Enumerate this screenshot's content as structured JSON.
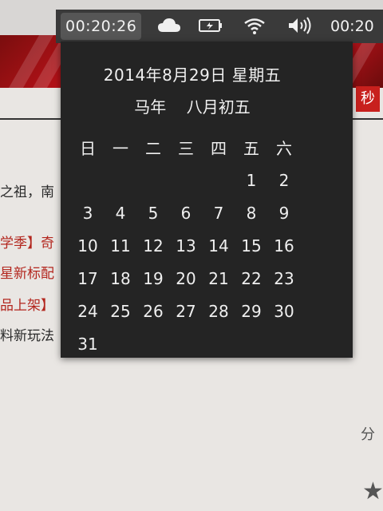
{
  "panel": {
    "clock_time": "00:20:26",
    "right_clock": "00:20",
    "icons": [
      "cloud-icon",
      "battery-icon",
      "wifi-icon",
      "volume-icon"
    ]
  },
  "calendar": {
    "date_line": "2014年8月29日 星期五",
    "lunar_line": "马年    八月初五",
    "weekdays": [
      "日",
      "一",
      "二",
      "三",
      "四",
      "五",
      "六"
    ],
    "weeks": [
      [
        "",
        "",
        "",
        "",
        "",
        "1",
        "2"
      ],
      [
        "3",
        "4",
        "5",
        "6",
        "7",
        "8",
        "9"
      ],
      [
        "10",
        "11",
        "12",
        "13",
        "14",
        "15",
        "16"
      ],
      [
        "17",
        "18",
        "19",
        "20",
        "21",
        "22",
        "23"
      ],
      [
        "24",
        "25",
        "26",
        "27",
        "28",
        "29",
        "30"
      ],
      [
        "31",
        "",
        "",
        "",
        "",
        "",
        ""
      ]
    ]
  },
  "background_page": {
    "badge": "秒",
    "lines": [
      "之祖，南",
      "学季】奇",
      "星新标配",
      "品上架】",
      "料新玩法"
    ],
    "share_label": "分",
    "star_glyph": "★"
  }
}
